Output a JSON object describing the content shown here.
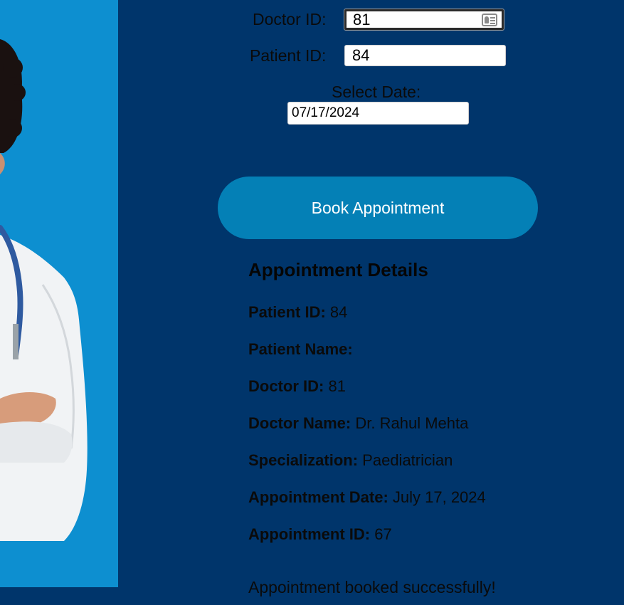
{
  "form": {
    "doctor_id_label": "Doctor ID:",
    "doctor_id_value": "81",
    "patient_id_label": "Patient ID:",
    "patient_id_value": "84",
    "date_label": "Select Date:",
    "date_value": "07/17/2024",
    "book_button_label": "Book Appointment"
  },
  "details": {
    "title": "Appointment Details",
    "rows": [
      {
        "label": "Patient ID:",
        "value": "84"
      },
      {
        "label": "Patient Name:",
        "value": ""
      },
      {
        "label": "Doctor ID:",
        "value": "81"
      },
      {
        "label": "Doctor Name:",
        "value": "Dr. Rahul Mehta"
      },
      {
        "label": "Specialization:",
        "value": "Paediatrician"
      },
      {
        "label": "Appointment Date:",
        "value": "July 17, 2024"
      },
      {
        "label": "Appointment ID:",
        "value": "67"
      }
    ]
  },
  "status_message": "Appointment booked successfully!",
  "colors": {
    "page_bg": "#00356b",
    "photo_bg": "#0d8fd0",
    "button_bg": "#0480b6"
  }
}
